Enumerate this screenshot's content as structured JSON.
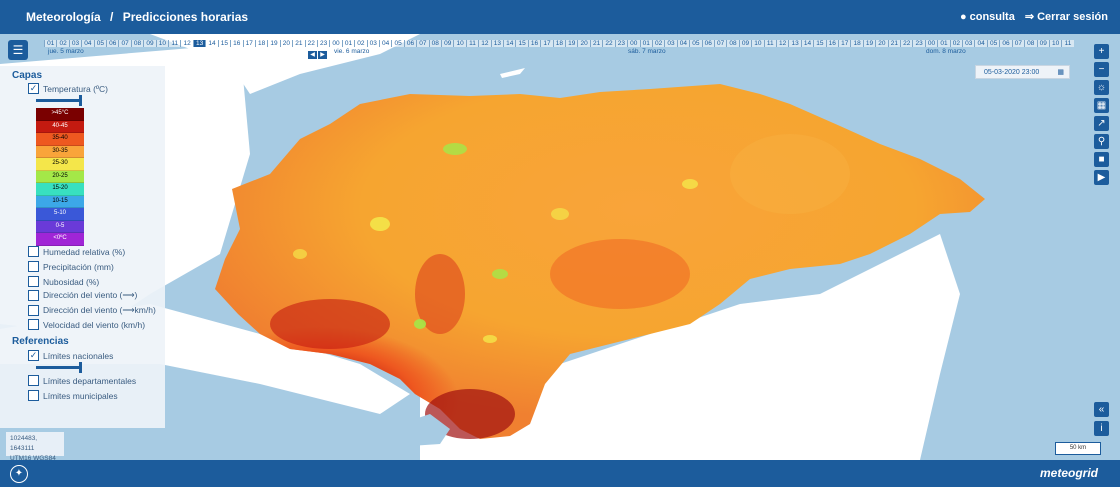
{
  "breadcrumb": {
    "root": "Meteorología",
    "sep": "/",
    "page": "Predicciones horarias"
  },
  "user": {
    "consulta": "consulta",
    "logout": "Cerrar sesión"
  },
  "timeline": {
    "days": [
      "jue. 5 marzo",
      "vie. 6 marzo",
      "sáb. 7 marzo",
      "dom. 8 marzo"
    ],
    "hours_first_day": [
      "01",
      "02",
      "03",
      "04",
      "05",
      "06",
      "07",
      "08",
      "09",
      "10",
      "11",
      "12",
      "13",
      "14",
      "15",
      "16",
      "17",
      "18",
      "19",
      "20",
      "21",
      "22",
      "23"
    ],
    "hours_full_day": [
      "00",
      "01",
      "02",
      "03",
      "04",
      "05",
      "06",
      "07",
      "08",
      "09",
      "10",
      "11",
      "12",
      "13",
      "14",
      "15",
      "16",
      "17",
      "18",
      "19",
      "20",
      "21",
      "22",
      "23"
    ],
    "hours_last_day": [
      "00",
      "01",
      "02",
      "03",
      "04",
      "05",
      "06",
      "07",
      "08",
      "09",
      "10",
      "11"
    ],
    "selected_hour": "13",
    "current_datetime": "05-03-2020 23:00"
  },
  "panel": {
    "layers_title": "Capas",
    "temperature": "Temperatura (ºC)",
    "legend": [
      {
        "label": ">45°C",
        "color": "#7a0000",
        "text": "#fff"
      },
      {
        "label": "40-45",
        "color": "#c41a10",
        "text": "#fff"
      },
      {
        "label": "35-40",
        "color": "#ee5820",
        "text": "#000"
      },
      {
        "label": "30-35",
        "color": "#f9a43a",
        "text": "#000"
      },
      {
        "label": "25-30",
        "color": "#f4e64a",
        "text": "#000"
      },
      {
        "label": "20-25",
        "color": "#a4e848",
        "text": "#000"
      },
      {
        "label": "15-20",
        "color": "#38e0c0",
        "text": "#000"
      },
      {
        "label": "10-15",
        "color": "#3ca8e8",
        "text": "#000"
      },
      {
        "label": "5-10",
        "color": "#3a58d8",
        "text": "#fff"
      },
      {
        "label": "0-5",
        "color": "#6a3ad8",
        "text": "#fff"
      },
      {
        "label": "<0ºC",
        "color": "#a025d6",
        "text": "#fff"
      }
    ],
    "other_layers": [
      "Humedad relativa (%)",
      "Precipitación (mm)",
      "Nubosidad (%)",
      "Dirección del viento (⟶)",
      "Dirección del viento (⟶km/h)",
      "Velocidad del viento (km/h)"
    ],
    "references_title": "Referencias",
    "references": [
      "Límites nacionales",
      "Límites departamentales",
      "Límites municipales"
    ]
  },
  "coords": {
    "xy": "1024483, 1643111",
    "proj": "UTM16 WGS84"
  },
  "scale": "50 km",
  "brand": "meteogrid",
  "colors": {
    "bar": "#1c5c9c",
    "sea": "#a7cbe3",
    "land": "#ffffff"
  }
}
